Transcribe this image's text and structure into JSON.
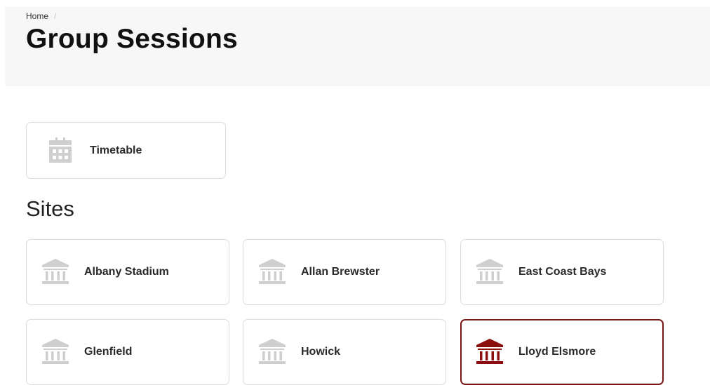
{
  "breadcrumb": {
    "home": "Home",
    "separator": "/"
  },
  "page": {
    "title": "Group Sessions"
  },
  "timetable": {
    "label": "Timetable",
    "icon": "calendar-icon"
  },
  "sites": {
    "heading": "Sites",
    "icon": "building-icon",
    "items": [
      {
        "label": "Albany Stadium",
        "active": false
      },
      {
        "label": "Allan Brewster",
        "active": false
      },
      {
        "label": "East Coast Bays",
        "active": false
      },
      {
        "label": "Glenfield",
        "active": false
      },
      {
        "label": "Howick",
        "active": false
      },
      {
        "label": "Lloyd Elsmore",
        "active": true
      }
    ]
  },
  "colors": {
    "icon_inactive": "#cfcfcf",
    "icon_active": "#8b0f0f",
    "active_border": "#7a1818",
    "header_bg": "#f7f7f7"
  }
}
